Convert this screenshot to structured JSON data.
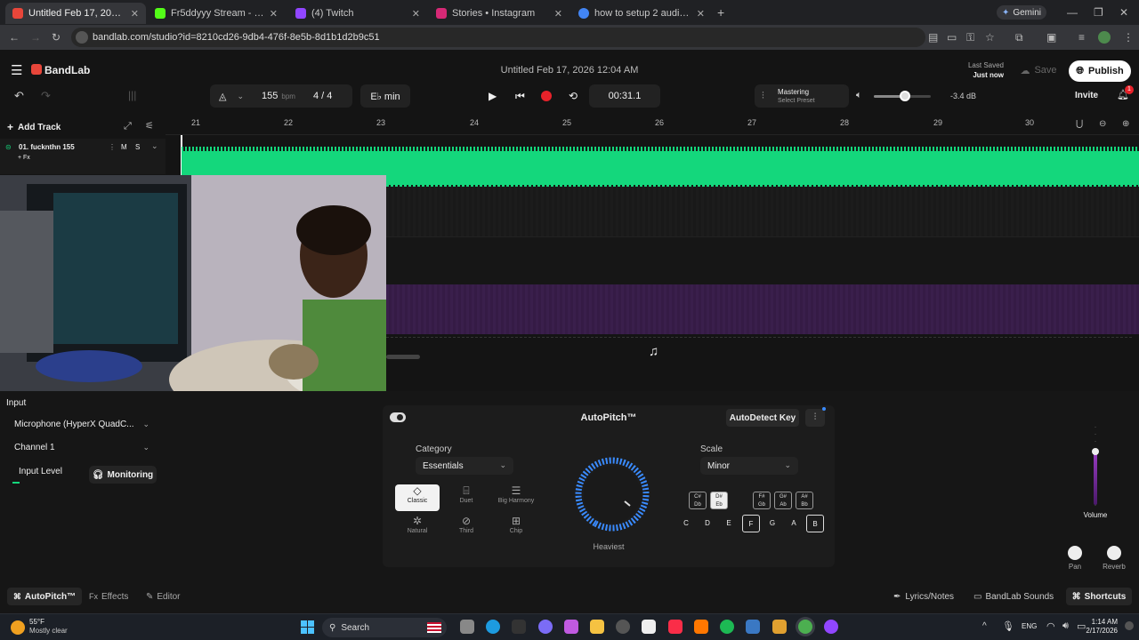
{
  "browser": {
    "tabs": [
      {
        "title": "Untitled Feb 17, 2026 12:0",
        "color": "#e8463a"
      },
      {
        "title": "Fr5ddyyy Stream - Watch Live o",
        "color": "#53fc18"
      },
      {
        "title": "(4) Twitch",
        "color": "#9146ff"
      },
      {
        "title": "Stories • Instagram",
        "color": "#d62976"
      },
      {
        "title": "how to setup 2 audio outputs u",
        "color": "#4285f4"
      }
    ],
    "gemini_label": "Gemini",
    "url": "bandlab.com/studio?id=8210cd26-9db4-476f-8e5b-8d1b1d2b9c51"
  },
  "app": {
    "brand": "BandLab",
    "project_title": "Untitled Feb 17, 2026 12:04 AM",
    "last_saved_label": "Last Saved",
    "last_saved_value": "Just now",
    "save_label": "Save",
    "publish_label": "Publish",
    "invite_label": "Invite",
    "notification_count": "1",
    "tempo": "155",
    "tempo_unit": "bpm",
    "time_sig": "4 / 4",
    "key": "E♭ min",
    "time": "00:31.1",
    "mastering_label": "Mastering",
    "mastering_preset": "Select Preset",
    "volume_db": "-3.4 dB",
    "master_volume_fraction": 0.55,
    "add_track_label": "Add Track"
  },
  "track": {
    "name": "01. fucknthn 155",
    "mute": "M",
    "solo": "S",
    "fx": "+ Fx",
    "color": "#14d77c"
  },
  "ruler": [
    "21",
    "22",
    "23",
    "24",
    "25",
    "26",
    "27",
    "28",
    "29",
    "30"
  ],
  "input_panel": {
    "heading": "Input",
    "device": "Microphone (HyperX QuadC...",
    "channel": "Channel 1",
    "input_level_label": "Input Level",
    "monitoring_label": "Monitoring"
  },
  "autopitch": {
    "title": "AutoPitch™",
    "autodetect_label": "AutoDetect Key",
    "category_label": "Category",
    "category_value": "Essentials",
    "styles": [
      "Classic",
      "Duet",
      "Big Harmony",
      "Natural",
      "Third",
      "Chip"
    ],
    "selected_style": "Classic",
    "knob_label": "Heaviest",
    "scale_label": "Scale",
    "scale_value": "Minor",
    "accidentals": [
      {
        "top": "C#",
        "bottom": "Db",
        "selected": false
      },
      {
        "top": "D#",
        "bottom": "Eb",
        "selected": true
      },
      {
        "top": "F#",
        "bottom": "Gb",
        "selected": false
      },
      {
        "top": "G#",
        "bottom": "Ab",
        "selected": false
      },
      {
        "top": "A#",
        "bottom": "Bb",
        "selected": false
      }
    ],
    "naturals": [
      {
        "note": "C",
        "selected": false
      },
      {
        "note": "D",
        "selected": false
      },
      {
        "note": "E",
        "selected": false
      },
      {
        "note": "F",
        "selected": true
      },
      {
        "note": "G",
        "selected": false
      },
      {
        "note": "A",
        "selected": false
      },
      {
        "note": "B",
        "selected": true
      }
    ]
  },
  "right_panel": {
    "volume_label": "Volume",
    "pan_label": "Pan",
    "reverb_label": "Reverb"
  },
  "footer": {
    "tabs": [
      "AutoPitch™",
      "Effects",
      "Editor"
    ],
    "lyrics": "Lyrics/Notes",
    "sounds": "BandLab Sounds",
    "shortcuts": "Shortcuts"
  },
  "taskbar": {
    "temp": "55°F",
    "weather": "Mostly clear",
    "search": "Search",
    "lang": "ENG",
    "time": "1:14 AM",
    "date": "2/17/2026"
  }
}
